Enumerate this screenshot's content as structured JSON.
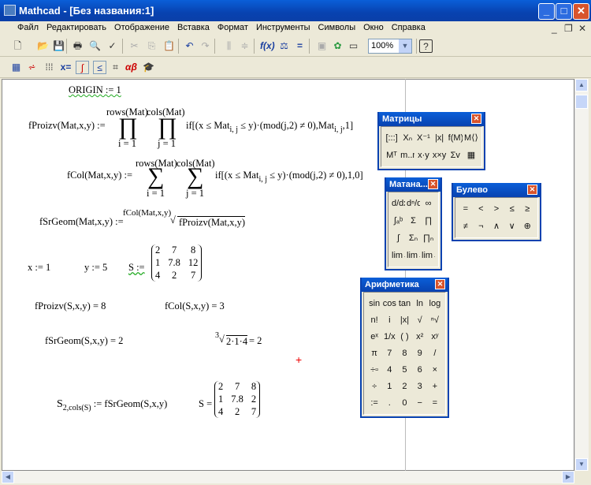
{
  "window": {
    "title": "Mathcad - [Без названия:1]",
    "min": "_",
    "max": "□",
    "close": "✕"
  },
  "menu": [
    "Файл",
    "Редактировать",
    "Отображение",
    "Вставка",
    "Формат",
    "Инструменты",
    "Символы",
    "Окно",
    "Справка"
  ],
  "mdi": {
    "min": "_",
    "restore": "❐",
    "close": "✕"
  },
  "toolbar": {
    "zoom": "100%"
  },
  "math": {
    "origin": "ORIGIN := 1",
    "fproizv_def": "fProizv(Mat,x,y) :=",
    "rows": "rows(Mat)",
    "cols": "cols(Mat)",
    "i1": "i = 1",
    "j1": "j = 1",
    "prod": "∏",
    "sum": "∑",
    "fproizv_body": "if[(x ≤ Mat",
    "ij": "i, j",
    "fproizv_body2": "≤ y)·(mod(j,2) ≠ 0),Mat",
    "fproizv_body3": ",1]",
    "fcol_def": "fCol(Mat,x,y) :=",
    "fcol_body2": "≤ y)·(mod(j,2) ≠ 0),1,0]",
    "fsr_def": "fSrGeom(Mat,x,y) :=",
    "fsr_idx": "fCol(Mat,x,y)",
    "fsr_rad": "fProizv(Mat,x,y)",
    "x_def": "x := 1",
    "y_def": "y := 5",
    "s_def": "S :=",
    "S": [
      [
        "2",
        "7",
        "8"
      ],
      [
        "1",
        "7.8",
        "12"
      ],
      [
        "4",
        "2",
        "7"
      ]
    ],
    "fproizv_res": "fProizv(S,x,y) = 8",
    "fcol_res": "fCol(S,x,y) = 3",
    "fsr_res": "fSrGeom(S,x,y) = 2",
    "root_idx": "3",
    "root_body": "2·1·4",
    "root_res": "= 2",
    "assign_lhs": "S",
    "assign_sub": "2,cols(S)",
    "assign_rhs": ":= fSrGeom(S,x,y)",
    "s_eq": "S =",
    "S2": [
      [
        "2",
        "7",
        "8"
      ],
      [
        "1",
        "7.8",
        "2"
      ],
      [
        "4",
        "2",
        "7"
      ]
    ]
  },
  "palettes": {
    "matrices": {
      "title": "Матрицы",
      "buttons": [
        "[:::]",
        "Xₙ",
        "X⁻¹",
        "|x|",
        "f(M)",
        "M⟨⟩",
        "Mᵀ",
        "m..n",
        "x·y",
        "x×y",
        "Σv",
        "▦"
      ]
    },
    "calculus": {
      "title": "Матана...",
      "buttons": [
        "d/dx",
        "dⁿ/dxⁿ",
        "∞",
        "∫ₐᵇ",
        "Σ",
        "∏",
        "∫",
        "Σₙ",
        "∏ₙ",
        "lim→a",
        "lim→a⁺",
        "lim→a⁻"
      ]
    },
    "boolean": {
      "title": "Булево",
      "buttons": [
        "=",
        "<",
        ">",
        "≤",
        "≥",
        "≠",
        "¬",
        "∧",
        "∨",
        "⊕"
      ]
    },
    "arithmetic": {
      "title": "Арифметика",
      "buttons": [
        "sin",
        "cos",
        "tan",
        "ln",
        "log",
        "n!",
        "i",
        "|x|",
        "√",
        "ⁿ√",
        "eˣ",
        "1/x",
        "( )",
        "x²",
        "xʸ",
        "π",
        "7",
        "8",
        "9",
        "/",
        "÷▫",
        "4",
        "5",
        "6",
        "×",
        "÷",
        "1",
        "2",
        "3",
        "+",
        ":=",
        ".",
        "0",
        "−",
        "="
      ]
    }
  },
  "cursor": "+"
}
